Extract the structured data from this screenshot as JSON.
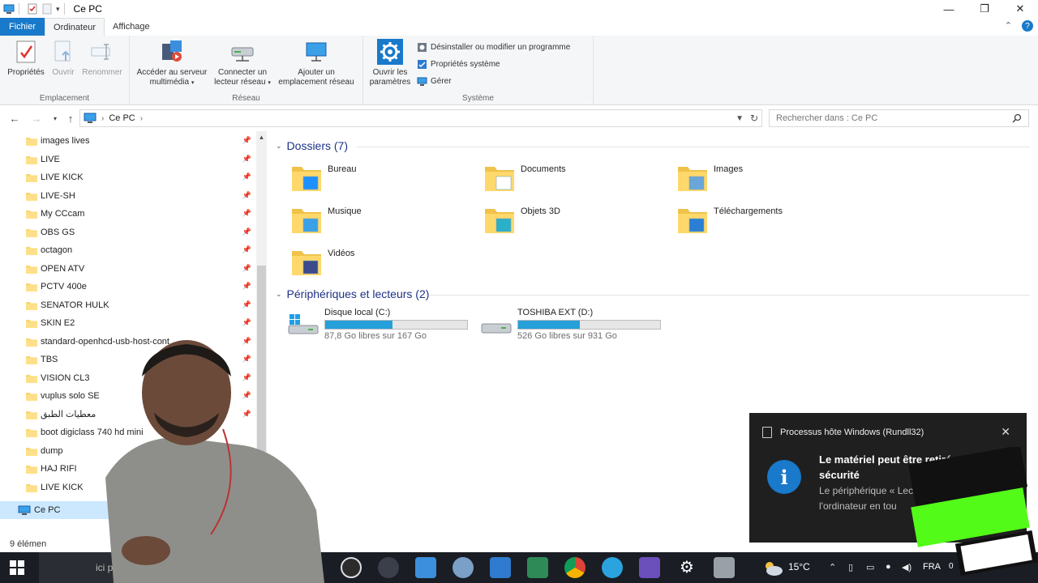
{
  "window": {
    "title": "Ce PC",
    "controls": [
      "minimize-icon",
      "maximize-icon",
      "close-icon"
    ]
  },
  "ribbon": {
    "tabs": [
      {
        "label": "Fichier"
      },
      {
        "label": "Ordinateur"
      },
      {
        "label": "Affichage"
      }
    ],
    "groups": {
      "emplacement": {
        "label": "Emplacement",
        "proprietes": "Propriétés",
        "ouvrir": "Ouvrir",
        "renommer": "Renommer"
      },
      "reseau": {
        "label": "Réseau",
        "acceder_l1": "Accéder au serveur",
        "acceder_l2": "multimédia",
        "connecter_l1": "Connecter un",
        "connecter_l2": "lecteur réseau",
        "ajouter_l1": "Ajouter un",
        "ajouter_l2": "emplacement réseau"
      },
      "systeme": {
        "label": "Système",
        "ouvrir_params_l1": "Ouvrir les",
        "ouvrir_params_l2": "paramètres",
        "desinstaller": "Désinstaller ou modifier un programme",
        "proprietes_systeme": "Propriétés système",
        "gerer": "Gérer"
      }
    }
  },
  "address": {
    "path": "Ce PC",
    "search_placeholder": "Rechercher dans : Ce PC"
  },
  "navpane": {
    "items": [
      {
        "label": "images lives",
        "pinned": true
      },
      {
        "label": "LIVE",
        "pinned": true
      },
      {
        "label": "LIVE KICK",
        "pinned": true
      },
      {
        "label": "LIVE-SH",
        "pinned": true
      },
      {
        "label": "My CCcam",
        "pinned": true
      },
      {
        "label": "OBS GS",
        "pinned": true
      },
      {
        "label": "octagon",
        "pinned": true
      },
      {
        "label": "OPEN ATV",
        "pinned": true
      },
      {
        "label": "PCTV 400e",
        "pinned": true
      },
      {
        "label": "SENATOR HULK",
        "pinned": true
      },
      {
        "label": "SKIN E2",
        "pinned": true
      },
      {
        "label": "standard-openhcd-usb-host-cont",
        "pinned": true
      },
      {
        "label": "TBS",
        "pinned": true
      },
      {
        "label": "VISION CL3",
        "pinned": true
      },
      {
        "label": "vuplus solo SE",
        "pinned": true
      },
      {
        "label": "معطيات الطبق",
        "pinned": true
      },
      {
        "label": "boot digiclass 740 hd mini",
        "pinned": false
      },
      {
        "label": "dump",
        "pinned": false
      },
      {
        "label": "HAJ RIFI",
        "pinned": false
      },
      {
        "label": "LIVE KICK",
        "pinned": false
      }
    ],
    "this_pc": "Ce PC"
  },
  "content": {
    "folders_header": "Dossiers (7)",
    "folders": [
      {
        "label": "Bureau",
        "icon": "desktop-folder-icon"
      },
      {
        "label": "Documents",
        "icon": "documents-folder-icon"
      },
      {
        "label": "Images",
        "icon": "pictures-folder-icon"
      },
      {
        "label": "Musique",
        "icon": "music-folder-icon"
      },
      {
        "label": "Objets 3D",
        "icon": "3d-objects-folder-icon"
      },
      {
        "label": "Téléchargements",
        "icon": "downloads-folder-icon"
      },
      {
        "label": "Vidéos",
        "icon": "videos-folder-icon"
      }
    ],
    "devices_header": "Périphériques et lecteurs (2)",
    "drives": [
      {
        "name": "Disque local (C:)",
        "free": "87,8 Go libres sur 167 Go",
        "used_fraction": 0.474
      },
      {
        "name": "TOSHIBA EXT (D:)",
        "free": "526 Go libres sur 931 Go",
        "used_fraction": 0.435
      }
    ]
  },
  "statusbar": {
    "count": "9 élémen"
  },
  "taskbar": {
    "search_text": "ici po",
    "temperature": "15°C",
    "language": "FRA",
    "clock": "0"
  },
  "toast": {
    "app": "Processus hôte Windows (Rundll32)",
    "title": "Le matériel peut être retiré en tout sécurité",
    "body": "Le périphérique « Lec peut maintenant être l'ordinateur en tou"
  },
  "colors": {
    "accent": "#1979ca",
    "drive_fill": "#26a0da",
    "section_header": "#1e3287",
    "selection": "#cce8ff",
    "taskbar": "#1a1d24",
    "toast_bg": "#1f1f1f"
  }
}
